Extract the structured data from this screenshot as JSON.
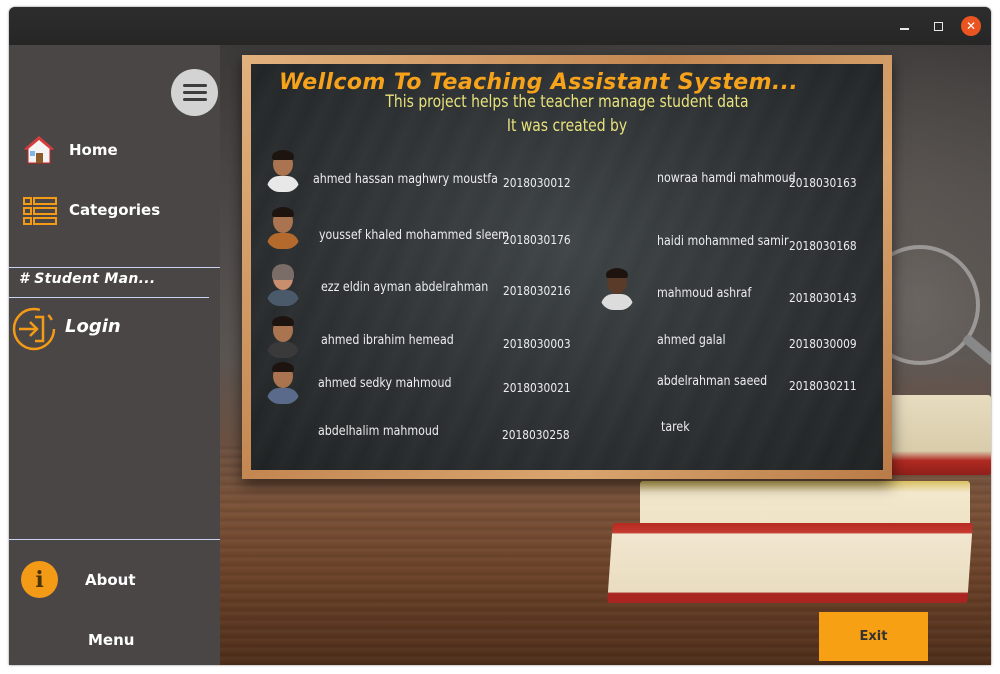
{
  "window": {
    "minimize_icon": "minimize-icon",
    "maximize_icon": "maximize-icon",
    "close_icon": "close-icon",
    "close_color": "#e95420"
  },
  "sidebar": {
    "menu_icon": "hamburger-icon",
    "items": [
      {
        "label": "Home",
        "icon": "home-icon"
      },
      {
        "label": "Categories",
        "icon": "list-icon"
      }
    ],
    "section_label": "# Student Man...",
    "login": {
      "label": "Login",
      "icon": "login-icon"
    },
    "about": {
      "label": "About",
      "icon": "info-icon"
    },
    "menu_label": "Menu",
    "accent_color": "#f39a17"
  },
  "board": {
    "title": "Wellcom To Teaching Assistant System...",
    "subtitle1": "This project helps the teacher manage student data",
    "subtitle2": "It was created by",
    "title_color": "#f7a21b",
    "students_left": [
      {
        "name": "ahmed hassan maghwry moustfa",
        "id": "2018030012"
      },
      {
        "name": "youssef khaled mohammed sleem",
        "id": "2018030176"
      },
      {
        "name": "ezz eldin  ayman abdelrahman",
        "id": "2018030216"
      },
      {
        "name": "ahmed ibrahim hemead",
        "id": "2018030003"
      },
      {
        "name": "ahmed sedky mahmoud",
        "id": "2018030021"
      },
      {
        "name": "abdelhalim mahmoud",
        "id": "2018030258"
      }
    ],
    "students_right": [
      {
        "name": "nowraa hamdi mahmoud",
        "id": "2018030163"
      },
      {
        "name": "haidi mohammed samir",
        "id": "2018030168"
      },
      {
        "name": "mahmoud ashraf",
        "id": "2018030143"
      },
      {
        "name": "ahmed galal",
        "id": "2018030009"
      },
      {
        "name": "abdelrahman saeed",
        "id": "2018030211"
      },
      {
        "name": "tarek",
        "id": ""
      }
    ]
  },
  "exit_button": {
    "label": "Exit",
    "color": "#f7a013"
  }
}
